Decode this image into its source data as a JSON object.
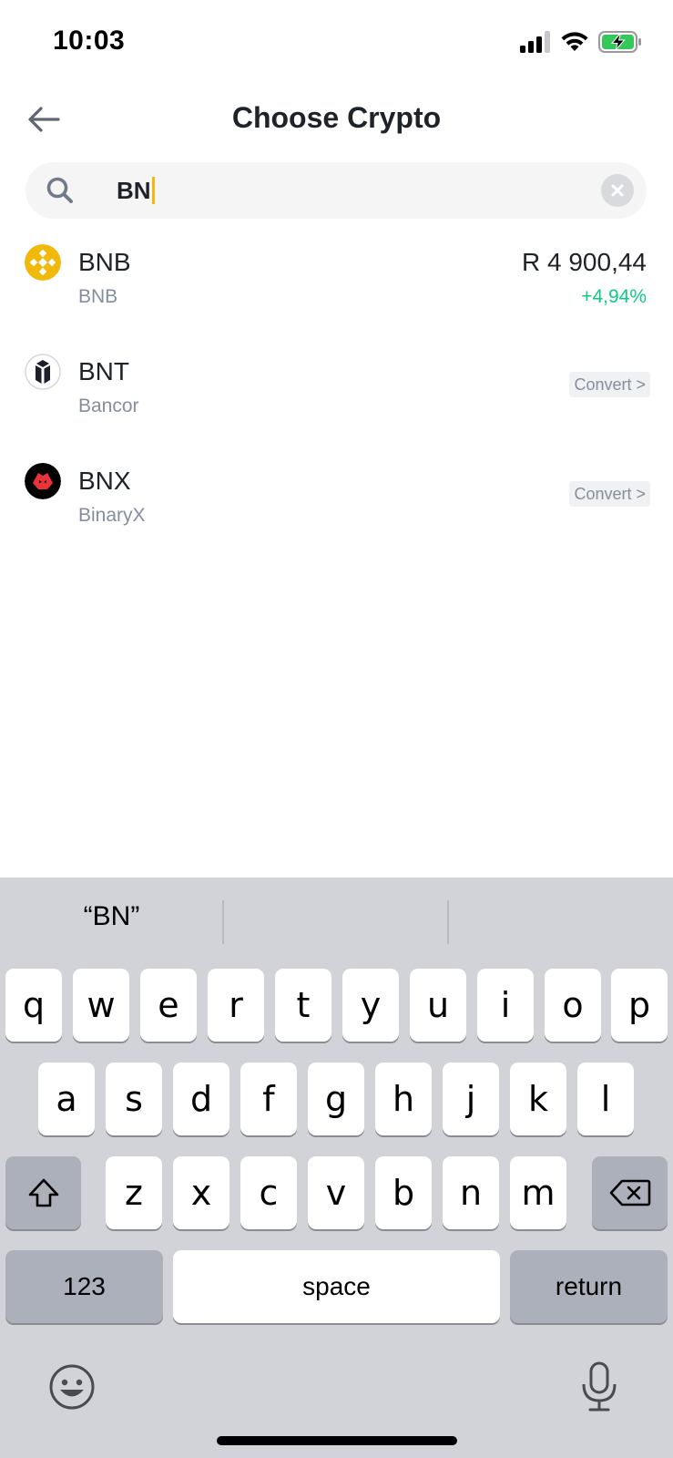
{
  "status_bar": {
    "time": "10:03",
    "icons": [
      "cellular-signal-icon",
      "wifi-icon",
      "battery-charging-icon"
    ]
  },
  "header": {
    "title": "Choose Crypto",
    "back_icon": "back-arrow-icon"
  },
  "search": {
    "value": "BN",
    "icon": "search-icon",
    "clear_icon": "clear-icon"
  },
  "coins": [
    {
      "symbol": "BNB",
      "name": "BNB",
      "price": "R 4 900,44",
      "change": "+4,94%",
      "logo": "bnb-logo",
      "logo_color": "#f0b90b"
    },
    {
      "symbol": "BNT",
      "name": "Bancor",
      "action": "Convert >",
      "logo": "bancor-logo",
      "logo_color": "#1c1f2b"
    },
    {
      "symbol": "BNX",
      "name": "BinaryX",
      "action": "Convert >",
      "logo": "binaryx-logo",
      "logo_color": "#000000"
    }
  ],
  "keyboard": {
    "suggestions": [
      "“BN”",
      "",
      ""
    ],
    "row1": [
      "q",
      "w",
      "e",
      "r",
      "t",
      "y",
      "u",
      "i",
      "o",
      "p"
    ],
    "row2": [
      "a",
      "s",
      "d",
      "f",
      "g",
      "h",
      "j",
      "k",
      "l"
    ],
    "row3": [
      "z",
      "x",
      "c",
      "v",
      "b",
      "n",
      "m"
    ],
    "numbers_label": "123",
    "space_label": "space",
    "return_label": "return",
    "icons": [
      "shift-icon",
      "backspace-icon",
      "emoji-icon",
      "microphone-icon"
    ]
  },
  "colors": {
    "accent": "#f0b90b",
    "positive": "#0ecb81",
    "secondary_text": "#848e9c",
    "keyboard_bg": "#d1d3d9"
  }
}
